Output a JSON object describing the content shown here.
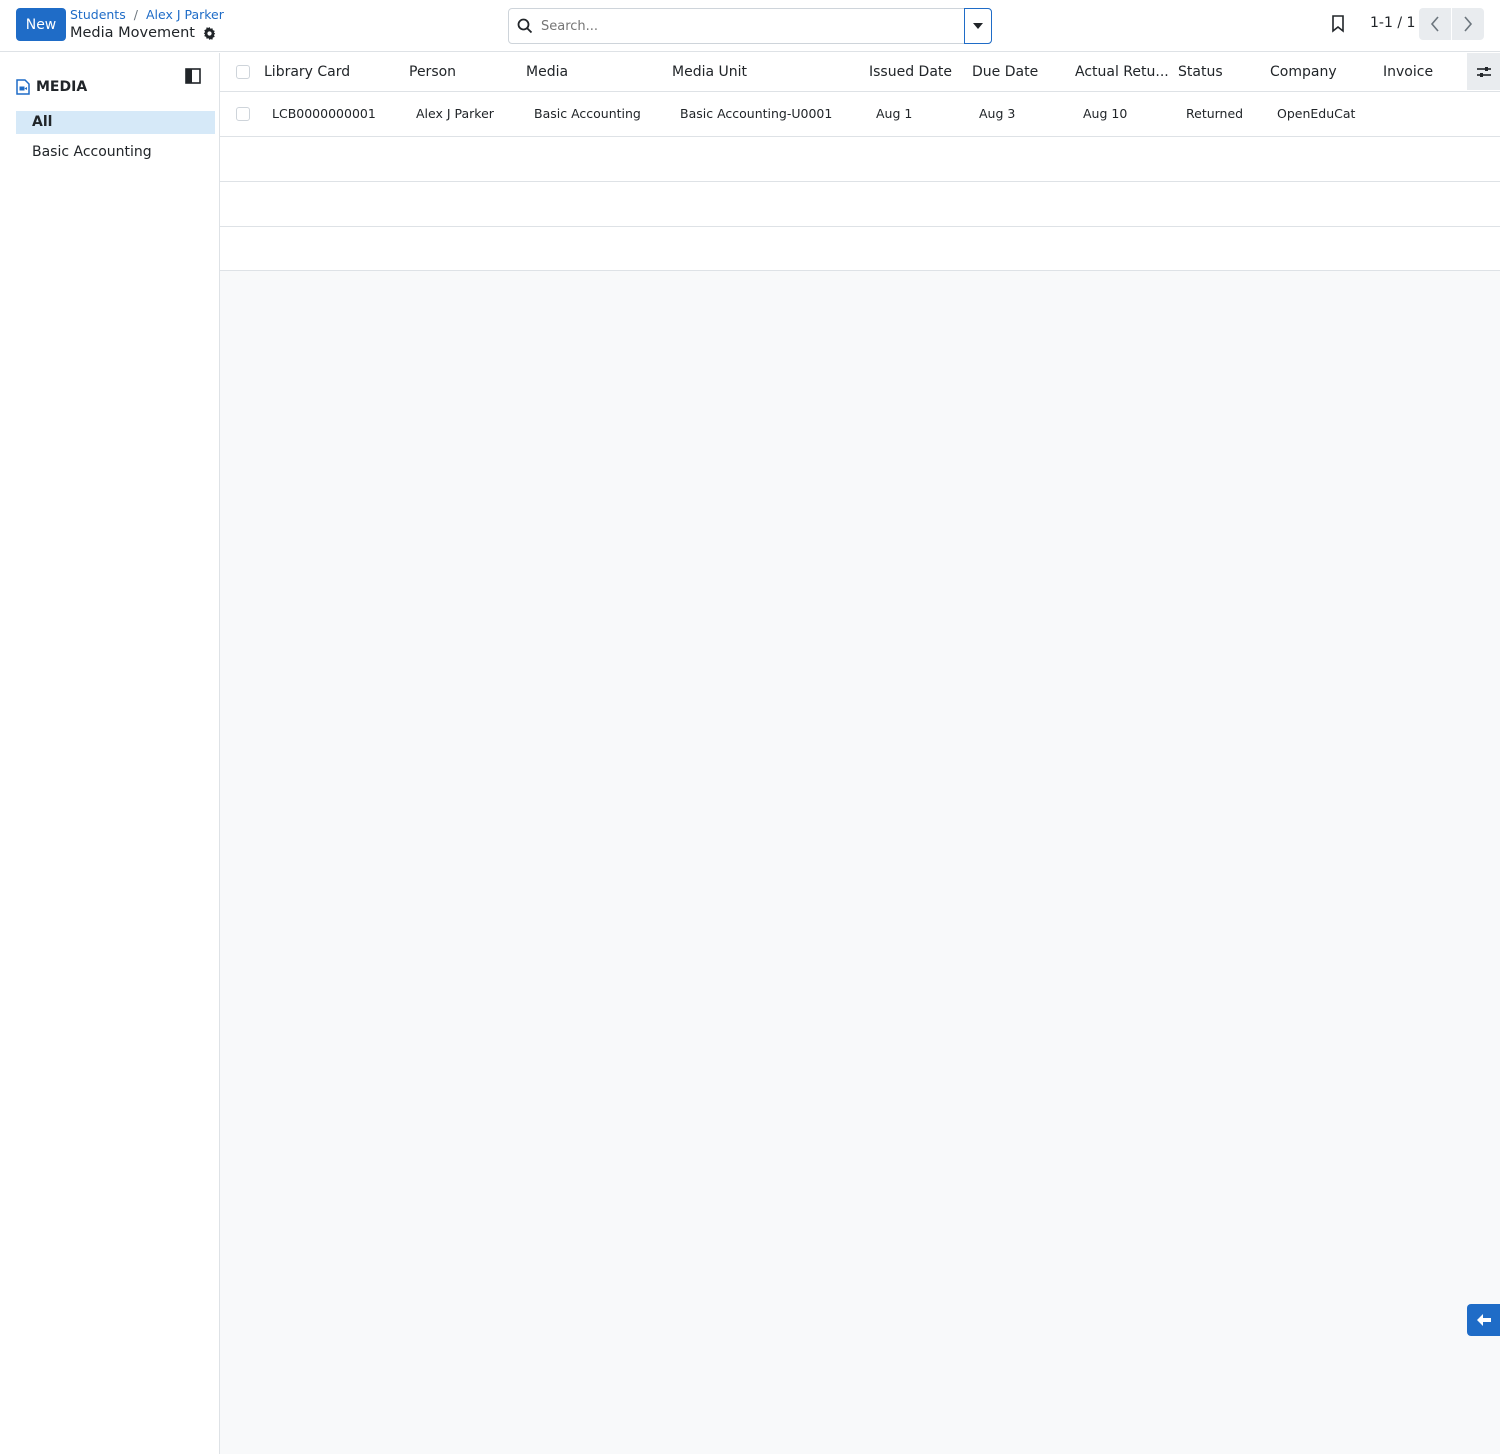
{
  "header": {
    "new_label": "New",
    "breadcrumbs": [
      "Students",
      "Alex J Parker"
    ],
    "breadcrumb_sep": "/",
    "title": "Media Movement",
    "search_placeholder": "Search...",
    "pager": "1-1 / 1"
  },
  "sidebar": {
    "heading": "MEDIA",
    "items": [
      {
        "label": "All",
        "active": true
      },
      {
        "label": "Basic Accounting",
        "active": false
      }
    ]
  },
  "table": {
    "columns": [
      "Library Card",
      "Person",
      "Media",
      "Media Unit",
      "Issued Date",
      "Due Date",
      "Actual Retu...",
      "Status",
      "Company",
      "Invoice"
    ],
    "rows": [
      [
        "LCB0000000001",
        "Alex J Parker",
        "Basic Accounting",
        "Basic Accounting-U0001",
        "Aug 1",
        "Aug 3",
        "Aug 10",
        "Returned",
        "OpenEduCat",
        ""
      ]
    ]
  },
  "colors": {
    "primary": "#1f6cc7",
    "active_bg": "#d6e9f8"
  }
}
